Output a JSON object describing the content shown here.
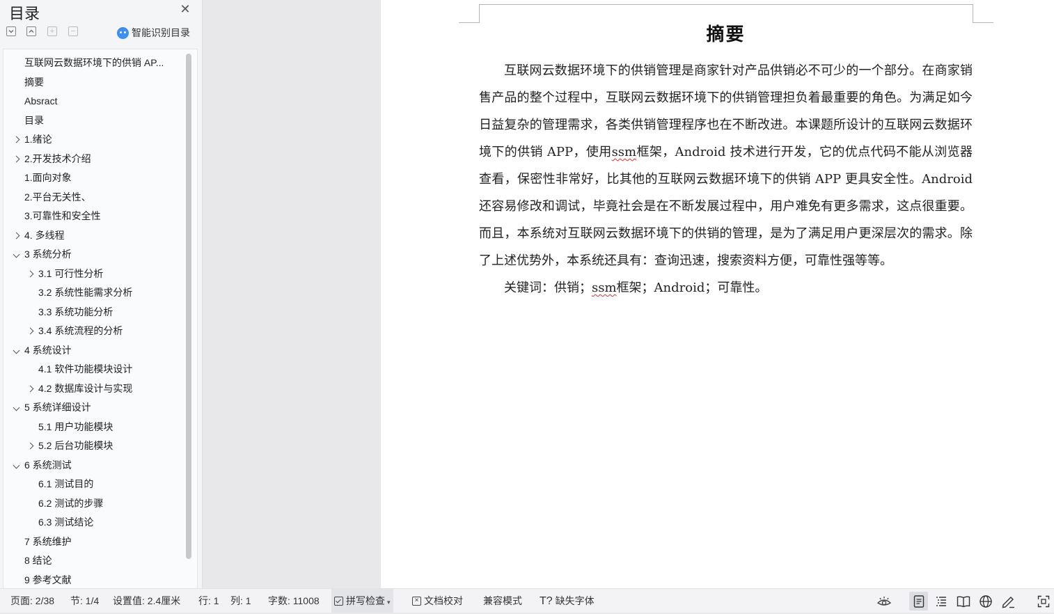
{
  "toc_panel": {
    "title": "目录",
    "smart_toc_label": "智能识别目录",
    "items": [
      {
        "label": "互联网云数据环境下的供销 AP...",
        "level": 1,
        "expander": "none"
      },
      {
        "label": "摘要",
        "level": 1,
        "expander": "none"
      },
      {
        "label": "Absract",
        "level": 1,
        "expander": "none"
      },
      {
        "label": "目录",
        "level": 1,
        "expander": "none"
      },
      {
        "label": "1.绪论",
        "level": 1,
        "expander": "collapsed"
      },
      {
        "label": "2.开发技术介绍",
        "level": 1,
        "expander": "collapsed"
      },
      {
        "label": "1.面向对象",
        "level": 1,
        "expander": "none"
      },
      {
        "label": "2.平台无关性、",
        "level": 1,
        "expander": "none"
      },
      {
        "label": "3.可靠性和安全性",
        "level": 1,
        "expander": "none"
      },
      {
        "label": "4. 多线程",
        "level": 1,
        "expander": "collapsed"
      },
      {
        "label": "3 系统分析",
        "level": 1,
        "expander": "expanded"
      },
      {
        "label": "3.1 可行性分析",
        "level": 2,
        "expander": "collapsed"
      },
      {
        "label": "3.2 系统性能需求分析",
        "level": 2,
        "expander": "none"
      },
      {
        "label": "3.3 系统功能分析",
        "level": 2,
        "expander": "none"
      },
      {
        "label": "3.4 系统流程的分析",
        "level": 2,
        "expander": "collapsed"
      },
      {
        "label": "4 系统设计",
        "level": 1,
        "expander": "expanded"
      },
      {
        "label": "4.1  软件功能模块设计",
        "level": 2,
        "expander": "none"
      },
      {
        "label": "4.2  数据库设计与实现",
        "level": 2,
        "expander": "collapsed"
      },
      {
        "label": "5  系统详细设计",
        "level": 1,
        "expander": "expanded"
      },
      {
        "label": "5.1 用户功能模块",
        "level": 2,
        "expander": "none"
      },
      {
        "label": "5.2 后台功能模块",
        "level": 2,
        "expander": "collapsed"
      },
      {
        "label": "6  系统测试",
        "level": 1,
        "expander": "expanded"
      },
      {
        "label": "6.1  测试目的",
        "level": 2,
        "expander": "none"
      },
      {
        "label": "6.2  测试的步骤",
        "level": 2,
        "expander": "none"
      },
      {
        "label": "6.3 测试结论",
        "level": 2,
        "expander": "none"
      },
      {
        "label": "7  系统维护",
        "level": 1,
        "expander": "none"
      },
      {
        "label": "8  结论",
        "level": 1,
        "expander": "none"
      },
      {
        "label": "9  参考文献",
        "level": 1,
        "expander": "none"
      }
    ]
  },
  "document": {
    "heading": "摘要",
    "body_parts": [
      "互联网云数据环境下的供销管理是商家针对产品供销必不可少的一个部分。在商家销售产品的整个过程中，互联网云数据环境下的供销管理担负着最重要的角色。为满足如今日益复杂的管理需求，各类供销管理程序也在不断改进。本课题所设计的互联网云数据环境下的供销 APP，使用",
      "ssm",
      "框架，Android 技术进行开发，它的优点代码不能从浏览器查看，保密性非常好，比其他的互联网云数据环境下的供销 APP 更具安全性。Android 还容易修改和调试，毕竟社会是在不断发展过程中，用户难免有更多需求，这点很重要。而且，本系统对互联网云数据环境下的供销的管理，是为了满足用户更深层次的需求。除了上述优势外，本系统还具有：查询迅速，搜索资料方便，可靠性强等等。"
    ],
    "keywords_parts": [
      "关键词：供销；",
      "ssm",
      "框架；Android；可靠性。"
    ]
  },
  "status_bar": {
    "page": "页面: 2/38",
    "section": "节: 1/4",
    "setting": "设置值: 2.4厘米",
    "row": "行: 1",
    "col": "列: 1",
    "word_count": "字数: 11008",
    "spell_check": "拼写检查",
    "doc_proof": "文档校对",
    "compat_mode": "兼容模式",
    "missing_fonts": "缺失字体"
  },
  "colors": {
    "accent": "#3d8ef0",
    "spell_underline": "#e03030"
  }
}
